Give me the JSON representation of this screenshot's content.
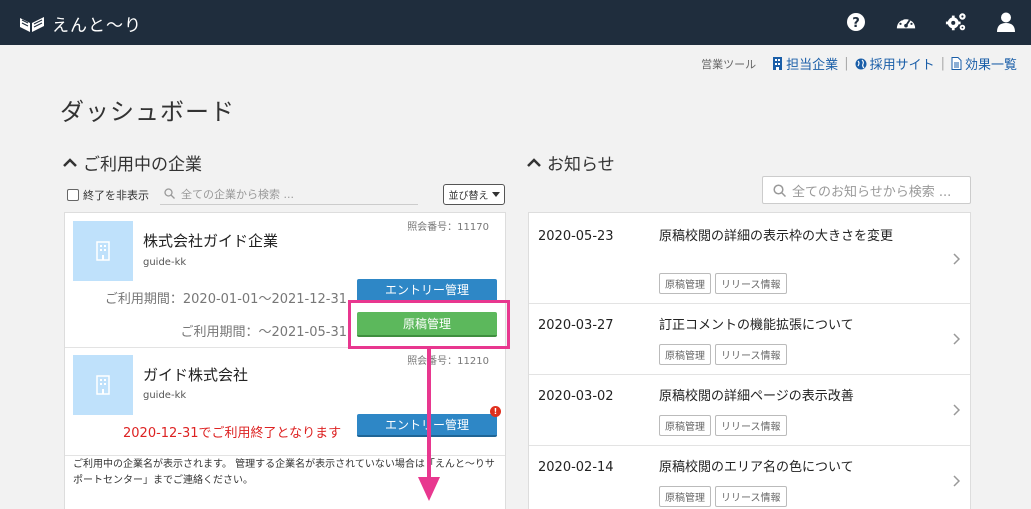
{
  "app": {
    "title": "えんと〜り"
  },
  "header": {
    "icons": [
      "help-icon",
      "dashboard-gauge-icon",
      "settings-gears-icon",
      "user-icon"
    ]
  },
  "utility": {
    "tool_label": "営業ツール",
    "links": [
      {
        "label": "担当企業",
        "icon": "building-icon"
      },
      {
        "label": "採用サイト",
        "icon": "globe-icon"
      },
      {
        "label": "効果一覧",
        "icon": "document-icon"
      }
    ]
  },
  "page_title": "ダッシュボード",
  "companies_section": {
    "title": "ご利用中の企業",
    "hide_ended_label": "終了を非表示",
    "hide_ended_checked": false,
    "search_placeholder": "全ての企業から検索 ...",
    "sort_label": "並び替え",
    "companies": [
      {
        "name": "株式会社ガイド企業",
        "id": "guide-kk",
        "ref_no": "照会番号：11170",
        "period_1": "ご利用期間：2020-01-01〜2021-12-31",
        "period_2": "ご利用期間：〜2021-05-31",
        "entry_button": "エントリー管理",
        "manuscript_button": "原稿管理"
      },
      {
        "name": "ガイド株式会社",
        "id": "guide-kk",
        "ref_no": "照会番号：11210",
        "ending_text": "2020-12-31でご利用終了となります",
        "entry_button": "エントリー管理",
        "alert": "!"
      }
    ],
    "note": "ご利用中の企業名が表示されます。 管理する企業名が表示されていない場合は「えんと〜りサポートセンター」までご連絡ください。"
  },
  "notices_section": {
    "title": "お知らせ",
    "search_placeholder": "全てのお知らせから検索 ...",
    "items": [
      {
        "date": "2020-05-23",
        "title": "原稿校閲の詳細の表示枠の大きさを変更",
        "tags": [
          "原稿管理",
          "リリース情報"
        ]
      },
      {
        "date": "2020-03-27",
        "title": "訂正コメントの機能拡張について",
        "tags": [
          "原稿管理",
          "リリース情報"
        ]
      },
      {
        "date": "2020-03-02",
        "title": "原稿校閲の詳細ページの表示改善",
        "tags": [
          "原稿管理",
          "リリース情報"
        ]
      },
      {
        "date": "2020-02-14",
        "title": "原稿校閲のエリア名の色について",
        "tags": [
          "原稿管理",
          "リリース情報"
        ]
      }
    ]
  },
  "colors": {
    "header_bg": "#1f2d3d",
    "link": "#1a5ea8",
    "entry_button": "#2e87c6",
    "manuscript_button": "#5cb85c",
    "annotation": "#e8378f",
    "warning_text": "#dd2222"
  }
}
